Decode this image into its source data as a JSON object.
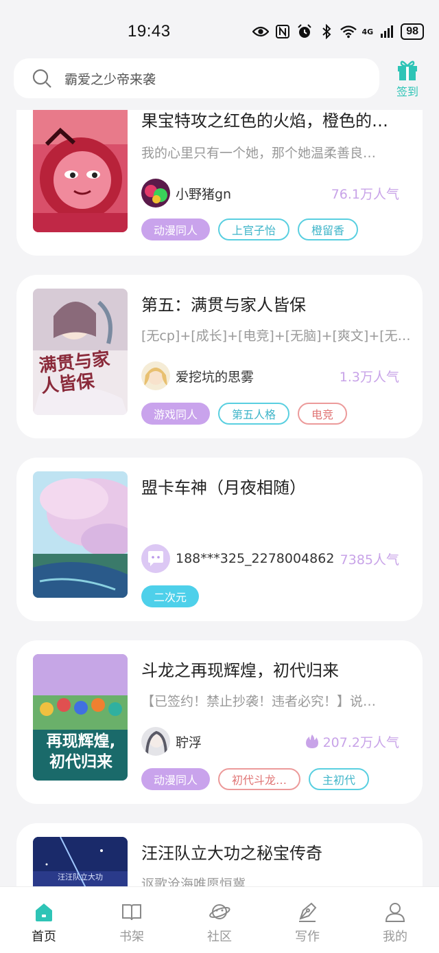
{
  "status": {
    "time": "19:43",
    "network": "4G",
    "battery": "98"
  },
  "header": {
    "search_text": "霸爱之少帝来袭",
    "signin_label": "签到"
  },
  "books": [
    {
      "title": "果宝特攻之红色的火焰，橙色的…",
      "desc": "我的心里只有一个她，那个她温柔善良…",
      "author": "小野猪gn",
      "popularity": "76.1万人气",
      "hot": false,
      "tags": [
        "动漫同人",
        "上官子怡",
        "橙留香"
      ]
    },
    {
      "title": "第五：满贯与家人皆保",
      "desc": "[无cp]+[成长]+[电竞]+[无脑]+[爽文]+[无…",
      "author": "爱挖坑的思雾",
      "popularity": "1.3万人气",
      "hot": false,
      "tags": [
        "游戏同人",
        "第五人格",
        "电竞"
      ],
      "cover_text": "满贯与家人皆保"
    },
    {
      "title": "盟卡车神（月夜相随）",
      "desc": "",
      "author": "188***325_2278004862",
      "popularity": "7385人气",
      "hot": false,
      "tags": [
        "二次元"
      ]
    },
    {
      "title": "斗龙之再现辉煌，初代归来",
      "desc": "【已签约！禁止抄袭！违者必究！】说…",
      "author": "聍浮",
      "popularity": "207.2万人气",
      "hot": true,
      "tags": [
        "动漫同人",
        "初代斗龙…",
        "主初代"
      ],
      "cover_text_1": "再现辉煌,",
      "cover_text_2": "初代归来"
    },
    {
      "title": "汪汪队立大功之秘宝传奇",
      "desc": "讴歌沧海唯愿恒冀",
      "cover_text": "汪汪队立大功"
    }
  ],
  "nav": [
    {
      "label": "首页",
      "icon": "home-icon",
      "active": true
    },
    {
      "label": "书架",
      "icon": "book-icon",
      "active": false
    },
    {
      "label": "社区",
      "icon": "planet-icon",
      "active": false
    },
    {
      "label": "写作",
      "icon": "pen-icon",
      "active": false
    },
    {
      "label": "我的",
      "icon": "user-icon",
      "active": false
    }
  ],
  "colors": {
    "accent": "#2ec4b6",
    "popularity": "#c8a3e8",
    "tag_purple": "#c9a3ec",
    "tag_cyan": "#4ed0ea",
    "tag_red_outline": "#ec9a9a"
  }
}
